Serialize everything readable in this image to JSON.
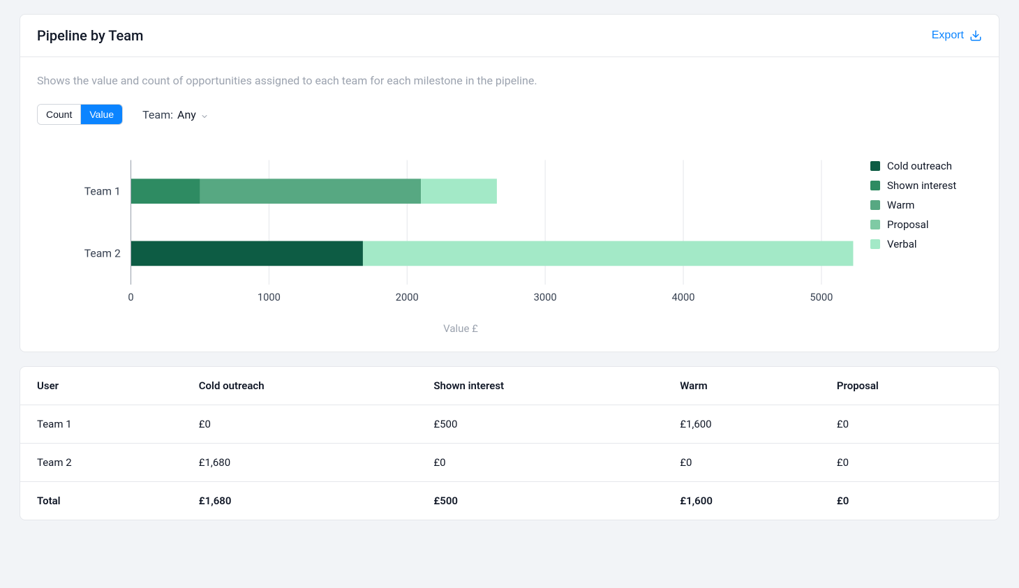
{
  "header": {
    "title": "Pipeline by Team",
    "export_label": "Export"
  },
  "description": "Shows the value and count of opportunities assigned to each team for each milestone in the pipeline.",
  "controls": {
    "seg_count": "Count",
    "seg_value": "Value",
    "team_label": "Team:",
    "team_selected": "Any"
  },
  "legend": [
    {
      "name": "Cold outreach",
      "color": "#0d5c44"
    },
    {
      "name": "Shown interest",
      "color": "#2e8b62"
    },
    {
      "name": "Warm",
      "color": "#57a882"
    },
    {
      "name": "Proposal",
      "color": "#7fcaa4"
    },
    {
      "name": "Verbal",
      "color": "#a3e9c7"
    }
  ],
  "chart_data": {
    "type": "bar",
    "orientation": "horizontal",
    "stacked": true,
    "xlabel": "Value £",
    "ylabel": "",
    "xlim": [
      0,
      5200
    ],
    "ticks": [
      0,
      1000,
      2000,
      3000,
      4000,
      5000
    ],
    "categories": [
      "Team 1",
      "Team 2"
    ],
    "series": [
      {
        "name": "Cold outreach",
        "color": "#0d5c44",
        "values": [
          0,
          1680
        ]
      },
      {
        "name": "Shown interest",
        "color": "#2e8b62",
        "values": [
          500,
          0
        ]
      },
      {
        "name": "Warm",
        "color": "#57a882",
        "values": [
          1600,
          0
        ]
      },
      {
        "name": "Proposal",
        "color": "#7fcaa4",
        "values": [
          0,
          0
        ]
      },
      {
        "name": "Verbal",
        "color": "#a3e9c7",
        "values": [
          550,
          3550
        ]
      }
    ]
  },
  "table": {
    "columns": [
      "User",
      "Cold outreach",
      "Shown interest",
      "Warm",
      "Proposal"
    ],
    "rows": [
      [
        "Team 1",
        "£0",
        "£500",
        "£1,600",
        "£0"
      ],
      [
        "Team 2",
        "£1,680",
        "£0",
        "£0",
        "£0"
      ],
      [
        "Total",
        "£1,680",
        "£500",
        "£1,600",
        "£0"
      ]
    ]
  }
}
